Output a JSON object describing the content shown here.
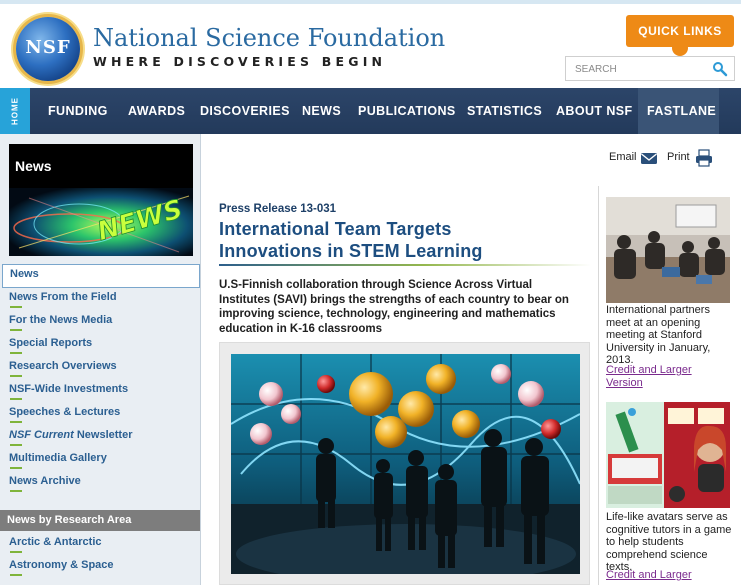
{
  "header": {
    "logo_text": "NSF",
    "title": "National Science Foundation",
    "tagline": "WHERE DISCOVERIES BEGIN",
    "quick_links": "QUICK LINKS",
    "search_placeholder": "SEARCH"
  },
  "nav": {
    "home": "HOME",
    "items": [
      "FUNDING",
      "AWARDS",
      "DISCOVERIES",
      "NEWS",
      "PUBLICATIONS",
      "STATISTICS",
      "ABOUT NSF",
      "FASTLANE"
    ]
  },
  "sidebar": {
    "news_title": "News",
    "news_graphic_text": "NEWS",
    "items": [
      {
        "label": "News",
        "active": true
      },
      {
        "label": "News From the Field"
      },
      {
        "label": "For the News Media"
      },
      {
        "label": "Special Reports"
      },
      {
        "label": "Research Overviews"
      },
      {
        "label": "NSF-Wide Investments"
      },
      {
        "label": "Speeches & Lectures"
      },
      {
        "label": "NSF Current",
        "label_suffix": " Newsletter"
      },
      {
        "label": "Multimedia Gallery"
      },
      {
        "label": "News Archive"
      }
    ],
    "research_heading": "News by Research Area",
    "research_items": [
      "Arctic & Antarctic",
      "Astronomy & Space"
    ]
  },
  "tools": {
    "email": "Email",
    "print": "Print"
  },
  "article": {
    "press_release": "Press Release 13-031",
    "headline_line1": "International Team Targets",
    "headline_line2": "Innovations in STEM Learning",
    "summary": "U.S-Finnish collaboration through Science Across Virtual Institutes (SAVI) brings the strengths of each country to bear on improving science, technology, engineering and mathematics education in K-16 classrooms"
  },
  "sidebar_right": {
    "items": [
      {
        "caption": "International partners meet at an opening meeting at Stanford University in January, 2013.",
        "credit_line1": "Credit and Larger",
        "credit_line2": "Version"
      },
      {
        "caption": "Life-like avatars serve as cognitive tutors in a game to help students comprehend science texts.",
        "credit_line1": "Credit and Larger"
      }
    ]
  },
  "colors": {
    "brand_blue": "#2a6aa1",
    "nav_bg": "#2c4569",
    "home_tab": "#27a3d9",
    "quick_links": "#ee8a16",
    "link": "#2b5f91",
    "credit_link": "#7a2a8d"
  }
}
